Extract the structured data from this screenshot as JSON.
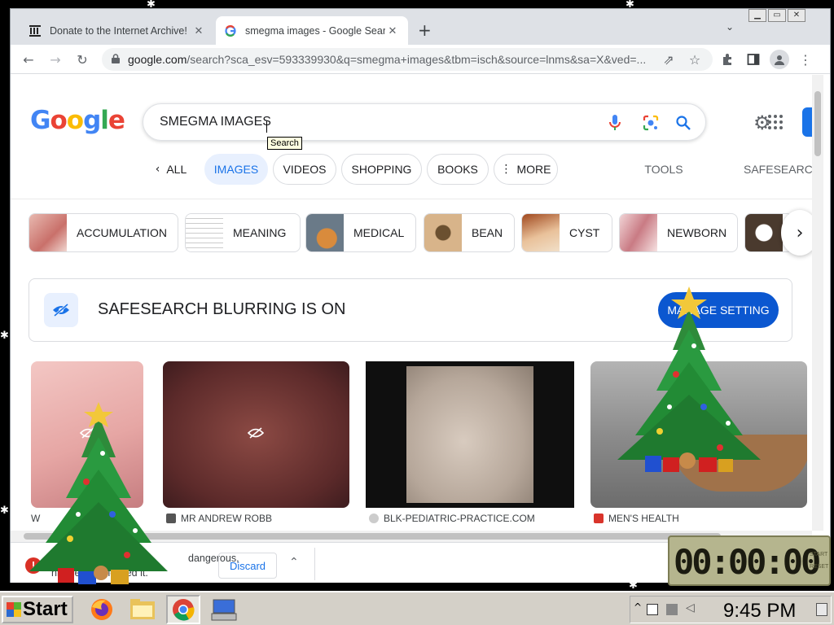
{
  "browser": {
    "tabs": [
      {
        "title": "Donate to the Internet Archive!",
        "active": false
      },
      {
        "title": "smegma images - Google Search",
        "active": true
      }
    ],
    "url": "google.com/search?sca_esv=593339930&q=smegma+images&tbm=isch&source=lnms&sa=X&ved=...",
    "url_host": "google.com",
    "url_rest": "/search?sca_esv=593339930&q=smegma+images&tbm=isch&source=lnms&sa=X&ved=..."
  },
  "google": {
    "logo_text": "Google",
    "query": "SMEGMA IMAGES",
    "tooltip": "Search",
    "nav": {
      "all": "ALL",
      "images": "IMAGES",
      "videos": "VIDEOS",
      "shopping": "SHOPPING",
      "books": "BOOKS",
      "more": "MORE",
      "tools": "TOOLS",
      "safesearch": "SAFESEARCH"
    },
    "refinements": [
      "ACCUMULATION",
      "MEANING",
      "MEDICAL",
      "BEAN",
      "CYST",
      "NEWBORN"
    ],
    "safesearch_notice": "SAFESEARCH BLURRING IS ON",
    "manage_setting": "MANAGE SETTING",
    "results": [
      {
        "source": "W"
      },
      {
        "source": "MR ANDREW ROBB"
      },
      {
        "source": "BLK-PEDIATRIC-PRACTICE.COM"
      },
      {
        "source": "MEN'S HEALTH"
      }
    ]
  },
  "download_bar": {
    "message_line1": "dangerous,",
    "message_line2": "hrome has blocked it.",
    "discard": "Discard"
  },
  "timer": {
    "display": "00:00:00",
    "labels": [
      "START",
      "RESET"
    ]
  },
  "taskbar": {
    "start": "Start",
    "clock": "9:45 PM"
  },
  "colors": {
    "accent": "#1a73e8",
    "manage_button": "#0b57d0",
    "active_chip": "#e8f0fe"
  },
  "icons": {
    "mic": "mic-icon",
    "lens": "lens-icon",
    "search": "search-icon",
    "settings": "gear-icon",
    "apps": "apps-grid-icon",
    "safesearch": "eye-slash-icon"
  }
}
